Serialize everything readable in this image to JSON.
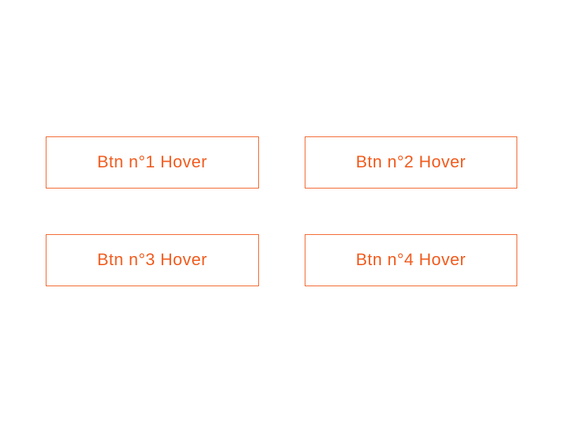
{
  "buttons": [
    {
      "label": "Btn n°1 Hover"
    },
    {
      "label": "Btn n°2 Hover"
    },
    {
      "label": "Btn n°3 Hover"
    },
    {
      "label": "Btn n°4 Hover"
    }
  ],
  "colors": {
    "accent": "#f25c1f"
  }
}
